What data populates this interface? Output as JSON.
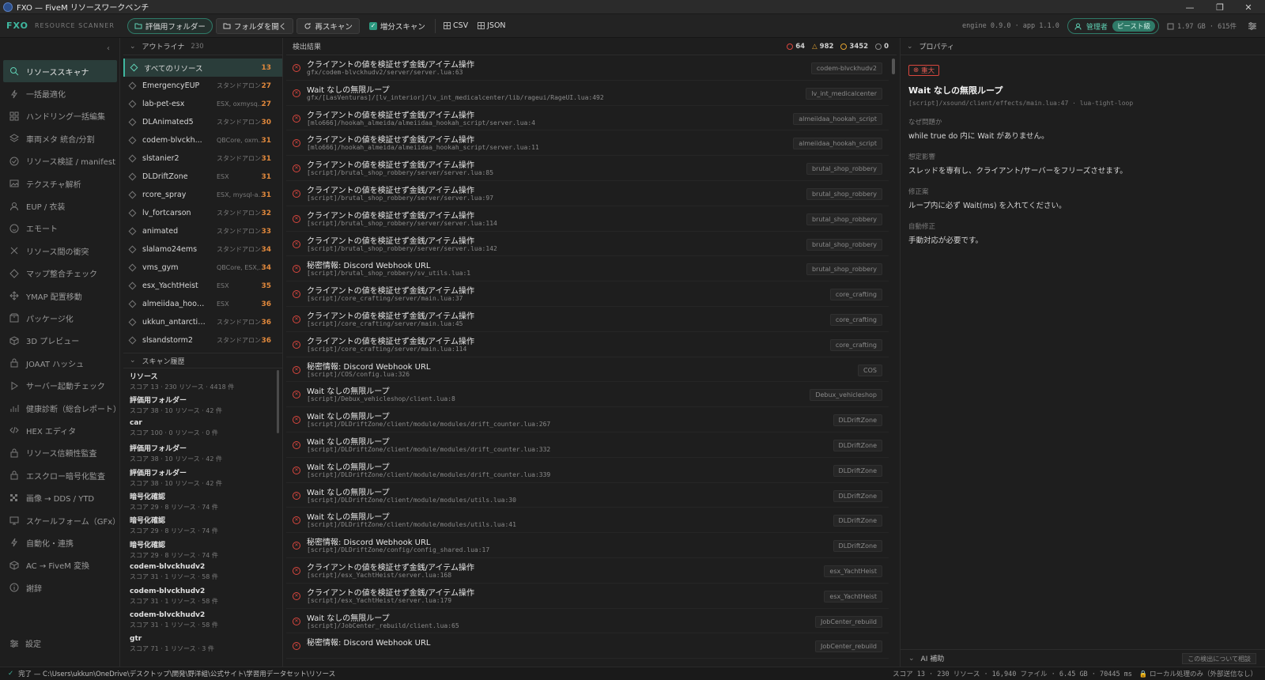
{
  "window": {
    "title": "FXO — FiveM リソースワークベンチ"
  },
  "toolbar": {
    "brand": "FXO",
    "brand_sub": "RESOURCE SCANNER",
    "btn_eval_folder": "評価用フォルダー",
    "btn_open_folder": "フォルダを開く",
    "btn_rescan": "再スキャン",
    "incremental_label": "増分スキャン",
    "csv_label": "CSV",
    "json_label": "JSON",
    "version": "engine 0.9.0 · app 1.1.0",
    "role": "管理者",
    "role_pill": "ビースト級",
    "memory": "1.97 GB · 615件"
  },
  "sidebar": {
    "items": [
      {
        "label": "リソーススキャナ",
        "icon": "search-icon",
        "active": true
      },
      {
        "label": "一括最適化",
        "icon": "bolt-icon"
      },
      {
        "label": "ハンドリング一括編集",
        "icon": "grid-icon"
      },
      {
        "label": "車両メタ 統合/分割",
        "icon": "layers-icon"
      },
      {
        "label": "リソース検証 / manifest",
        "icon": "check-circle-icon"
      },
      {
        "label": "テクスチャ解析",
        "icon": "image-icon"
      },
      {
        "label": "EUP / 衣装",
        "icon": "user-icon"
      },
      {
        "label": "エモート",
        "icon": "smile-icon"
      },
      {
        "label": "リソース間の衝突",
        "icon": "x-icon"
      },
      {
        "label": "マップ整合チェック",
        "icon": "diamond-icon"
      },
      {
        "label": "YMAP 配置移動",
        "icon": "move-icon"
      },
      {
        "label": "パッケージ化",
        "icon": "package-icon"
      },
      {
        "label": "3D プレビュー",
        "icon": "cube-icon"
      },
      {
        "label": "JOAAT ハッシュ",
        "icon": "hash-icon"
      },
      {
        "label": "サーバー起動チェック",
        "icon": "play-icon"
      },
      {
        "label": "健康診断（総合レポート）",
        "icon": "chart-icon"
      },
      {
        "label": "HEX エディタ",
        "icon": "code-icon"
      },
      {
        "label": "リソース信頼性監査",
        "icon": "lock-icon"
      },
      {
        "label": "エスクロー暗号化監査",
        "icon": "lock-icon"
      },
      {
        "label": "画像 → DDS / YTD",
        "icon": "checker-icon"
      },
      {
        "label": "スケールフォーム（GFx）",
        "icon": "monitor-icon"
      },
      {
        "label": "自動化・連携",
        "icon": "bolt-icon"
      },
      {
        "label": "AC → FiveM 変換",
        "icon": "cube-icon"
      },
      {
        "label": "謝辞",
        "icon": "info-icon"
      }
    ],
    "settings_label": "設定"
  },
  "outline": {
    "title": "アウトライナ",
    "count": "230",
    "all_label": "すべてのリソース",
    "all_count": "13",
    "rows": [
      {
        "name": "EmergencyEUP",
        "tag": "スタンドアロン",
        "score": "27"
      },
      {
        "name": "lab-pet-esx",
        "tag": "ESX, oxmysql, ...",
        "score": "27"
      },
      {
        "name": "DLAnimated5",
        "tag": "スタンドアロン",
        "score": "30"
      },
      {
        "name": "codem-blvckh...",
        "tag": "QBCore, oxmy...",
        "score": "31"
      },
      {
        "name": "slstanier2",
        "tag": "スタンドアロン",
        "score": "31"
      },
      {
        "name": "DLDriftZone",
        "tag": "ESX",
        "score": "31"
      },
      {
        "name": "rcore_spray",
        "tag": "ESX, mysql-asy...",
        "score": "31"
      },
      {
        "name": "lv_fortcarson",
        "tag": "スタンドアロン",
        "score": "32"
      },
      {
        "name": "animated",
        "tag": "スタンドアロン",
        "score": "33"
      },
      {
        "name": "slalamo24ems",
        "tag": "スタンドアロン",
        "score": "34"
      },
      {
        "name": "vms_gym",
        "tag": "QBCore, ESX, o...",
        "score": "34"
      },
      {
        "name": "esx_YachtHeist",
        "tag": "ESX",
        "score": "35"
      },
      {
        "name": "almeiidaa_hookah_script",
        "tag": "ESX",
        "score": "36"
      },
      {
        "name": "ukkun_antarctica",
        "tag": "スタンドアロン",
        "score": "36"
      },
      {
        "name": "slsandstorm2",
        "tag": "スタンドアロン",
        "score": "36"
      }
    ],
    "history_title": "スキャン履歴",
    "history": [
      {
        "name": "リソース",
        "meta": "スコア 13 · 230 リソース · 4418 件"
      },
      {
        "name": "評価用フォルダー",
        "meta": "スコア 38 · 10 リソース · 42 件"
      },
      {
        "name": "car",
        "meta": "スコア 100 · 0 リソース · 0 件"
      },
      {
        "name": "評価用フォルダー",
        "meta": "スコア 38 · 10 リソース · 42 件"
      },
      {
        "name": "評価用フォルダー",
        "meta": "スコア 38 · 10 リソース · 42 件"
      },
      {
        "name": "暗号化確認",
        "meta": "スコア 29 · 8 リソース · 74 件"
      },
      {
        "name": "暗号化確認",
        "meta": "スコア 29 · 8 リソース · 74 件"
      },
      {
        "name": "暗号化確認",
        "meta": "スコア 29 · 8 リソース · 74 件"
      },
      {
        "name": "codem-blvckhudv2",
        "meta": "スコア 31 · 1 リソース · 58 件"
      },
      {
        "name": "codem-blvckhudv2",
        "meta": "スコア 31 · 1 リソース · 58 件"
      },
      {
        "name": "codem-blvckhudv2",
        "meta": "スコア 31 · 1 リソース · 58 件"
      },
      {
        "name": "gtr",
        "meta": "スコア 71 · 1 リソース · 3 件"
      }
    ]
  },
  "results": {
    "title": "検出結果",
    "stats": {
      "critical": "64",
      "warning": "982",
      "info": "3452",
      "other": "0"
    },
    "rows": [
      {
        "title": "クライアントの値を検証せず金銭/アイテム操作",
        "path": "gfx/codem-blvckhudv2/server/server.lua:63",
        "badge": "codem-blvckhudv2"
      },
      {
        "title": "Wait なしの無限ループ",
        "path": "gfx/[LasVenturas]/[lv_interior]/lv_int_medicalcenter/lib/rageui/RageUI.lua:492",
        "badge": "lv_int_medicalcenter"
      },
      {
        "title": "クライアントの値を検証せず金銭/アイテム操作",
        "path": "[mlo666]/hookah_almeida/almeiidaa_hookah_script/server.lua:4",
        "badge": "almeiidaa_hookah_script"
      },
      {
        "title": "クライアントの値を検証せず金銭/アイテム操作",
        "path": "[mlo666]/hookah_almeida/almeiidaa_hookah_script/server.lua:11",
        "badge": "almeiidaa_hookah_script"
      },
      {
        "title": "クライアントの値を検証せず金銭/アイテム操作",
        "path": "[script]/brutal_shop_robbery/server/server.lua:85",
        "badge": "brutal_shop_robbery"
      },
      {
        "title": "クライアントの値を検証せず金銭/アイテム操作",
        "path": "[script]/brutal_shop_robbery/server/server.lua:97",
        "badge": "brutal_shop_robbery"
      },
      {
        "title": "クライアントの値を検証せず金銭/アイテム操作",
        "path": "[script]/brutal_shop_robbery/server/server.lua:114",
        "badge": "brutal_shop_robbery"
      },
      {
        "title": "クライアントの値を検証せず金銭/アイテム操作",
        "path": "[script]/brutal_shop_robbery/server/server.lua:142",
        "badge": "brutal_shop_robbery"
      },
      {
        "title": "秘密情報: Discord Webhook URL",
        "path": "[script]/brutal_shop_robbery/sv_utils.lua:1",
        "badge": "brutal_shop_robbery"
      },
      {
        "title": "クライアントの値を検証せず金銭/アイテム操作",
        "path": "[script]/core_crafting/server/main.lua:37",
        "badge": "core_crafting"
      },
      {
        "title": "クライアントの値を検証せず金銭/アイテム操作",
        "path": "[script]/core_crafting/server/main.lua:45",
        "badge": "core_crafting"
      },
      {
        "title": "クライアントの値を検証せず金銭/アイテム操作",
        "path": "[script]/core_crafting/server/main.lua:114",
        "badge": "core_crafting"
      },
      {
        "title": "秘密情報: Discord Webhook URL",
        "path": "[script]/COS/config.lua:326",
        "badge": "COS"
      },
      {
        "title": "Wait なしの無限ループ",
        "path": "[script]/Debux_vehicleshop/client.lua:8",
        "badge": "Debux_vehicleshop"
      },
      {
        "title": "Wait なしの無限ループ",
        "path": "[script]/DLDriftZone/client/module/modules/drift_counter.lua:267",
        "badge": "DLDriftZone"
      },
      {
        "title": "Wait なしの無限ループ",
        "path": "[script]/DLDriftZone/client/module/modules/drift_counter.lua:332",
        "badge": "DLDriftZone"
      },
      {
        "title": "Wait なしの無限ループ",
        "path": "[script]/DLDriftZone/client/module/modules/drift_counter.lua:339",
        "badge": "DLDriftZone"
      },
      {
        "title": "Wait なしの無限ループ",
        "path": "[script]/DLDriftZone/client/module/modules/utils.lua:30",
        "badge": "DLDriftZone"
      },
      {
        "title": "Wait なしの無限ループ",
        "path": "[script]/DLDriftZone/client/module/modules/utils.lua:41",
        "badge": "DLDriftZone"
      },
      {
        "title": "秘密情報: Discord Webhook URL",
        "path": "[script]/DLDriftZone/config/config_shared.lua:17",
        "badge": "DLDriftZone"
      },
      {
        "title": "クライアントの値を検証せず金銭/アイテム操作",
        "path": "[script]/esx_YachtHeist/server.lua:168",
        "badge": "esx_YachtHeist"
      },
      {
        "title": "クライアントの値を検証せず金銭/アイテム操作",
        "path": "[script]/esx_YachtHeist/server.lua:179",
        "badge": "esx_YachtHeist"
      },
      {
        "title": "Wait なしの無限ループ",
        "path": "[script]/JobCenter_rebuild/client.lua:65",
        "badge": "JobCenter_rebuild"
      },
      {
        "title": "秘密情報: Discord Webhook URL",
        "path": "",
        "badge": "JobCenter_rebuild"
      }
    ]
  },
  "props": {
    "title": "プロパティ",
    "severity": "重大",
    "finding_title": "Wait なしの無限ループ",
    "location": "[script]/xsound/client/effects/main.lua:47 · lua-tight-loop",
    "why_label": "なぜ問題か",
    "why": "while true do 内に Wait がありません。",
    "impact_label": "想定影響",
    "impact": "スレッドを専有し、クライアント/サーバーをフリーズさせます。",
    "fix_label": "修正案",
    "fix": "ループ内に必ず Wait(ms) を入れてください。",
    "auto_label": "自動修正",
    "auto": "手動対応が必要です。",
    "ai_label": "AI 補助",
    "ai_button": "この検出について相談"
  },
  "status": {
    "message": "完了 — C:\\Users\\ukkun\\OneDrive\\デスクトップ\\開発\\野洋組\\公式サイト\\学習用データセット\\リソース",
    "summary": "スコア 13 · 230 リソース · 16,940 ファイル · 6.45 GB · 70445 ms",
    "local": "ローカル処理のみ（外部送信なし）"
  },
  "colors": {
    "accent": "#3fb8a0",
    "critical": "#d9463e",
    "warning": "#e0a030",
    "score": "#e0883c"
  }
}
